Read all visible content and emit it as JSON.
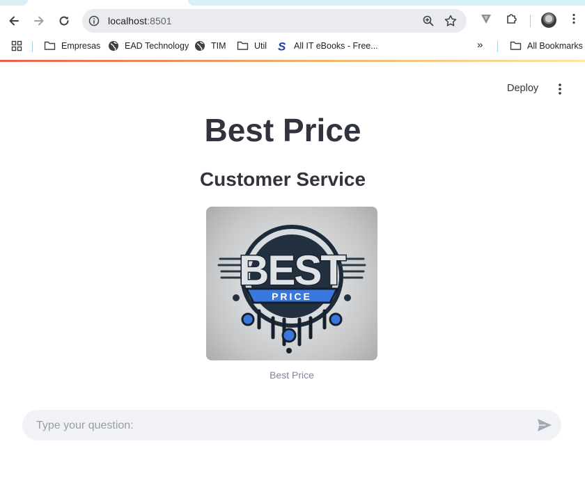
{
  "browser": {
    "url_host": "localhost",
    "url_port": ":8501",
    "bookmarks": [
      {
        "label": "Empresas",
        "icon": "folder-icon"
      },
      {
        "label": "EAD Technology",
        "icon": "globe-icon"
      },
      {
        "label": "TIM",
        "icon": "globe-icon"
      },
      {
        "label": "Util",
        "icon": "folder-icon"
      },
      {
        "label": "All IT eBooks - Free...",
        "icon": "s-logo-icon"
      }
    ],
    "overflow_label": "»",
    "all_bookmarks_label": "All Bookmarks"
  },
  "app": {
    "deploy_label": "Deploy",
    "title": "Best Price",
    "subtitle": "Customer Service",
    "logo_word": "BEST",
    "logo_sub": "PRICE",
    "image_caption": "Best Price",
    "chat_placeholder": "Type your question:"
  },
  "colors": {
    "text": "#31333f",
    "caption": "#808495",
    "input_bg": "#f0f2f6",
    "accent_gradient_start": "#e8614f",
    "accent_gradient_end": "#fbe6a5",
    "logo_blue": "#3a78e0"
  }
}
